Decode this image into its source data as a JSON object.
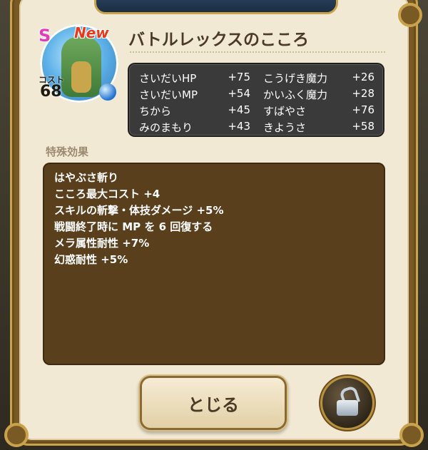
{
  "card": {
    "rank": "S",
    "new_badge": "New",
    "cost_label": "コスト",
    "cost": "68",
    "title": "バトルレックスのこころ"
  },
  "stats": [
    {
      "label1": "さいだいHP",
      "value1": "+75",
      "label2": "こうげき魔力",
      "value2": "+26"
    },
    {
      "label1": "さいだいMP",
      "value1": "+54",
      "label2": "かいふく魔力",
      "value2": "+28"
    },
    {
      "label1": "ちから",
      "value1": "+45",
      "label2": "すばやさ",
      "value2": "+76"
    },
    {
      "label1": "みのまもり",
      "value1": "+43",
      "label2": "きようさ",
      "value2": "+58"
    }
  ],
  "effects": {
    "heading": "特殊効果",
    "lines": [
      "はやぶさ斬り",
      "こころ最大コスト +4",
      "スキルの斬撃・体技ダメージ +5%",
      "戦闘終了時に MP を 6 回復する",
      "メラ属性耐性 +7%",
      "幻惑耐性 +5%"
    ]
  },
  "buttons": {
    "close_label": "とじる"
  },
  "icons": {
    "lock": "unlocked-padlock-icon",
    "orb": "blue-orb-icon"
  },
  "colors": {
    "rank": "#e23ab8",
    "new": "#e83a1a",
    "panel": "#f2e9d4",
    "effects_box": "#5a3f1c",
    "stats_box": "#3a3a3a"
  }
}
